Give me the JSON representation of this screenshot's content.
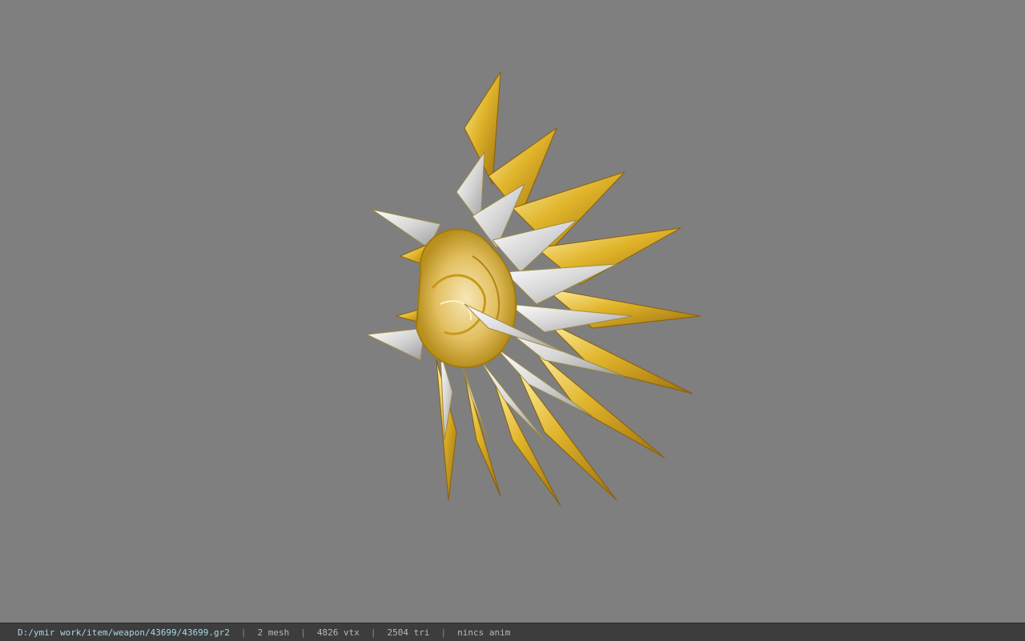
{
  "viewer": {
    "background_color": "#7f7f7f",
    "model_icon": "spiked-gold-shield-model"
  },
  "status": {
    "path": "D:/ymir work/item/weapon/43699/43699.gr2",
    "separator": "|",
    "mesh": "2 mesh",
    "vtx": "4826 vtx",
    "tri": "2504 tri",
    "anim": "nincs anim"
  }
}
